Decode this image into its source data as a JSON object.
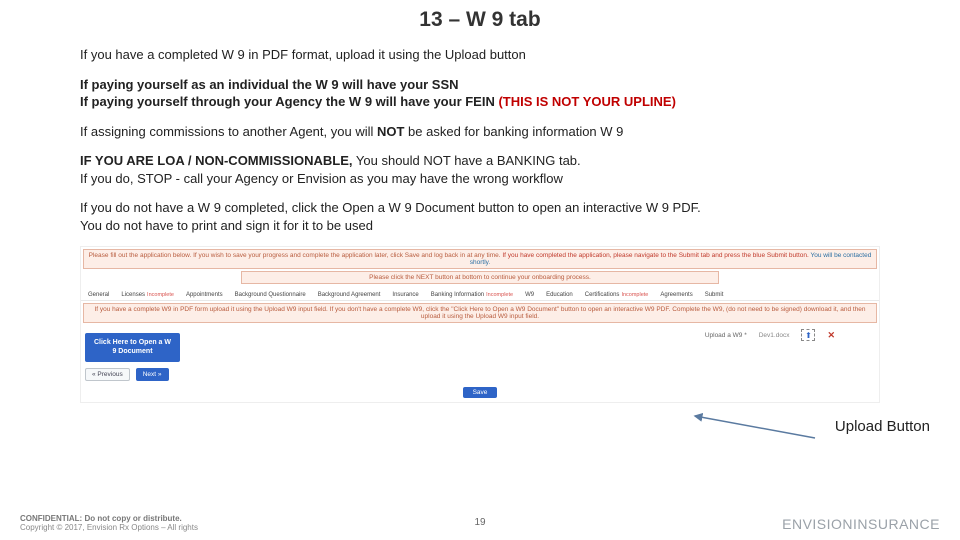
{
  "title": "13 – W 9 tab",
  "p1": "If you have a completed W 9 in PDF format, upload it using the Upload button",
  "p2a": "If paying yourself as an individual the W 9 will have your SSN",
  "p2b": "If paying yourself through your Agency the W 9 will have your FEIN ",
  "p2b_red": "(THIS IS NOT YOUR UPLINE)",
  "p3a": "If assigning commissions to another Agent, you will ",
  "p3b": "NOT",
  "p3c": " be asked for banking information W 9",
  "p4a": "IF YOU ARE LOA / NON-COMMISSIONABLE,",
  "p4b": " You should NOT have a BANKING  tab.",
  "p4c": "If you do, STOP - call your Agency or Envision as you may have the wrong workflow",
  "p5a": "If you do not have a W 9 completed, click the Open a W 9 Document button to open an interactive W 9 PDF.",
  "p5b": "You do not have to print and sign it for it to be used",
  "shot": {
    "banner1a": "Please fill out the application below. If you wish to save your progress and complete the application later, click Save and log back in at any time. ",
    "banner1b": "If you have completed the application, please navigate to the Submit tab and press the blue Submit button.",
    "banner1c": " You will be contacted shortly.",
    "banner2": "Please click the NEXT button at bottom to continue your onboarding process.",
    "tabs": [
      {
        "label": "General"
      },
      {
        "label": "Licenses",
        "inc": "Incomplete"
      },
      {
        "label": "Appointments"
      },
      {
        "label": "Background Questionnaire"
      },
      {
        "label": "Background Agreement"
      },
      {
        "label": "Insurance"
      },
      {
        "label": "Banking Information",
        "inc": "Incomplete"
      },
      {
        "label": "W9"
      },
      {
        "label": "Education"
      },
      {
        "label": "Certifications",
        "inc": "Incomplete"
      },
      {
        "label": "Agreements"
      },
      {
        "label": "Submit"
      }
    ],
    "banner3": "If you have a complete W9 in PDF form upload it using the Upload W9 input field. If you don't have a complete W9, click the \"Click Here to Open a W9 Document\" button to open an interactive W9 PDF. Complete the W9, (do not need to be signed) download it, and then upload it using the Upload W9 input field.",
    "open_btn": "Click Here to Open a W 9 Document",
    "upload_label": "Upload a W9 *",
    "upload_file": "Dev1.docx",
    "prev": "« Previous",
    "next": "Next »",
    "save": "Save"
  },
  "callout": "Upload Button",
  "footer": {
    "l1": "CONFIDENTIAL: Do not copy or distribute.",
    "l2": "Copyright © 2017, Envision Rx Options – All rights",
    "page": "19",
    "brand1": "ENVISION",
    "brand2": "INSURANCE"
  }
}
